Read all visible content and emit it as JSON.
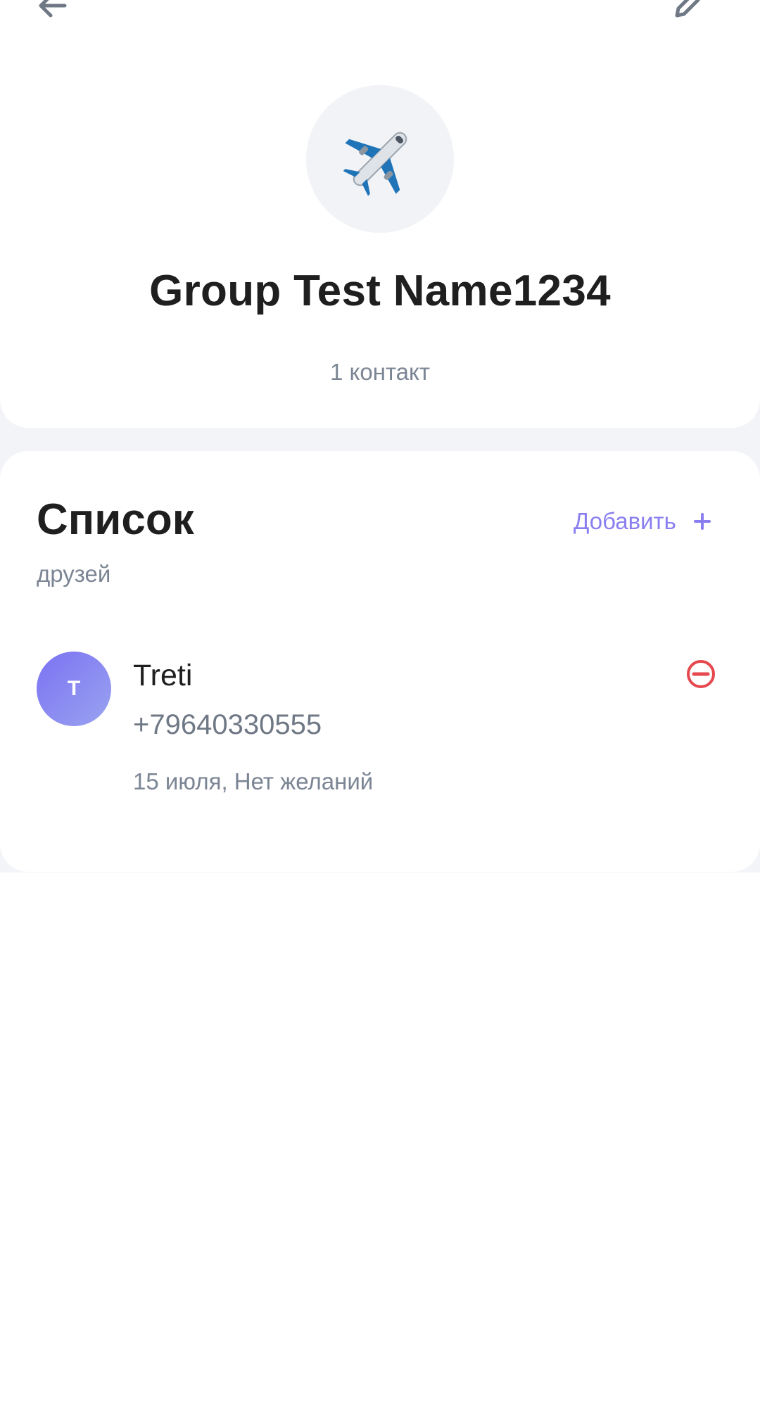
{
  "header": {
    "group_name": "Group Test Name1234",
    "contact_count": "1 контакт",
    "avatar_emoji": "✈️",
    "back_icon": "arrow-left-icon",
    "edit_icon": "pencil-icon"
  },
  "list": {
    "title": "Список",
    "subtitle": "друзей",
    "add_label": "Добавить",
    "add_icon": "plus-icon",
    "items": [
      {
        "initial": "T",
        "name": "Treti",
        "phone": "+79640330555",
        "meta": "15 июля, Нет желаний",
        "remove_icon": "minus-circle-icon"
      }
    ]
  },
  "colors": {
    "accent": "#8a7ff0",
    "danger": "#e5484d",
    "muted_text": "#7b8594",
    "background": "#f3f4f8"
  }
}
